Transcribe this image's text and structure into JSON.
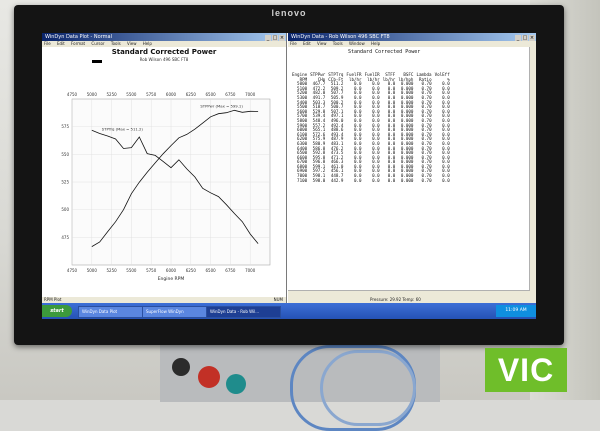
{
  "monitor": {
    "brand": "lenovo"
  },
  "left_window": {
    "title": "WinDyn Data Plot - Normal",
    "menu": [
      "File",
      "Edit",
      "Format",
      "Cursor",
      "Tools",
      "View",
      "Help"
    ],
    "status_left": "RPM Plot",
    "status_right": "NUM"
  },
  "right_window": {
    "title": "WinDyn Data - Rob Wilson 496 SBC FT8",
    "menu": [
      "File",
      "Edit",
      "View",
      "Tools",
      "Window",
      "Help"
    ],
    "report_title": "Standard Corrected Power",
    "columns_line1": [
      "Engine",
      "STPPwr",
      "STPTrq",
      "FuelFR",
      "FuelIR",
      "STFF",
      "BSFC",
      "Lambda",
      "VolEff"
    ],
    "columns_line2": [
      "RPM",
      "CHp",
      "CCb-Ft",
      "lb/hr",
      "lb/hr",
      "lb/hr",
      "lb/hph",
      "Ratio",
      "%"
    ],
    "rows": [
      [
        "5000",
        "467.7",
        "511.2",
        "0.0",
        "0.0",
        "0.0",
        "0.000",
        "0.70",
        "0.0"
      ],
      [
        "5100",
        "472.2",
        "509.2",
        "0.0",
        "0.0",
        "0.0",
        "0.000",
        "0.70",
        "0.0"
      ],
      [
        "5200",
        "482.0",
        "507.7",
        "0.0",
        "0.0",
        "0.0",
        "0.000",
        "0.70",
        "0.0"
      ],
      [
        "5300",
        "491.7",
        "505.9",
        "0.0",
        "0.0",
        "0.0",
        "0.000",
        "0.70",
        "0.0"
      ],
      [
        "5400",
        "503.3",
        "500.2",
        "0.0",
        "0.0",
        "0.0",
        "0.000",
        "0.70",
        "0.0"
      ],
      [
        "5500",
        "518.7",
        "500.7",
        "0.0",
        "0.0",
        "0.0",
        "0.000",
        "0.70",
        "0.0"
      ],
      [
        "5600",
        "529.8",
        "507.1",
        "0.0",
        "0.0",
        "0.0",
        "0.000",
        "0.70",
        "0.0"
      ],
      [
        "5700",
        "539.4",
        "497.1",
        "0.0",
        "0.0",
        "0.0",
        "0.000",
        "0.70",
        "0.0"
      ],
      [
        "5800",
        "548.4",
        "496.0",
        "0.0",
        "0.0",
        "0.0",
        "0.000",
        "0.70",
        "0.0"
      ],
      [
        "5900",
        "557.2",
        "492.4",
        "0.0",
        "0.0",
        "0.0",
        "0.000",
        "0.70",
        "0.0"
      ],
      [
        "6000",
        "565.1",
        "488.6",
        "0.0",
        "0.0",
        "0.0",
        "0.000",
        "0.70",
        "0.0"
      ],
      [
        "6100",
        "572.6",
        "493.4",
        "0.0",
        "0.0",
        "0.0",
        "0.000",
        "0.70",
        "0.0"
      ],
      [
        "6200",
        "575.9",
        "487.9",
        "0.0",
        "0.0",
        "0.0",
        "0.000",
        "0.70",
        "0.0"
      ],
      [
        "6300",
        "580.9",
        "483.1",
        "0.0",
        "0.0",
        "0.0",
        "0.000",
        "0.70",
        "0.0"
      ],
      [
        "6400",
        "586.8",
        "476.2",
        "0.0",
        "0.0",
        "0.0",
        "0.000",
        "0.70",
        "0.0"
      ],
      [
        "6500",
        "592.8",
        "473.5",
        "0.0",
        "0.0",
        "0.0",
        "0.000",
        "0.70",
        "0.0"
      ],
      [
        "6600",
        "595.8",
        "471.2",
        "0.0",
        "0.0",
        "0.0",
        "0.000",
        "0.70",
        "0.0"
      ],
      [
        "6700",
        "596.8",
        "466.3",
        "0.0",
        "0.0",
        "0.0",
        "0.000",
        "0.70",
        "0.0"
      ],
      [
        "6800",
        "599.1",
        "461.0",
        "0.0",
        "0.0",
        "0.0",
        "0.000",
        "0.70",
        "0.0"
      ],
      [
        "6900",
        "597.2",
        "456.1",
        "0.0",
        "0.0",
        "0.0",
        "0.000",
        "0.70",
        "0.0"
      ],
      [
        "7000",
        "598.1",
        "448.7",
        "0.0",
        "0.0",
        "0.0",
        "0.000",
        "0.70",
        "0.0"
      ],
      [
        "7100",
        "598.0",
        "442.9",
        "0.0",
        "0.0",
        "0.0",
        "0.000",
        "0.70",
        "0.0"
      ]
    ],
    "status_text": "Pressure: 29.92 Temp: 60"
  },
  "taskbar": {
    "start_label": "start",
    "tasks": [
      "WinDyn Data Plot",
      "SuperFlow WinDyn",
      "WinDyn Data - Rob Wil..."
    ],
    "clock": "11:09 AM"
  },
  "badge": {
    "text": "VIC",
    "color": "#6fbe2a"
  },
  "chart_data": {
    "type": "line",
    "title": "Standard Corrected Power",
    "subtitle": "Rob Wilson 496 SBC FT8",
    "xlabel": "Engine RPM",
    "x": [
      5000,
      5100,
      5200,
      5300,
      5400,
      5500,
      5600,
      5700,
      5800,
      5900,
      6000,
      6100,
      6200,
      6300,
      6400,
      6500,
      6600,
      6700,
      6800,
      6900,
      7000,
      7100
    ],
    "xlim": [
      4750,
      7250
    ],
    "xticks": [
      4750,
      5000,
      5250,
      5500,
      5750,
      6000,
      6250,
      6500,
      6750,
      7000
    ],
    "series": [
      {
        "name": "STPPwr (Max = 599.1)",
        "values": [
          467.7,
          472.2,
          482.0,
          491.7,
          503.3,
          518.7,
          529.8,
          539.4,
          548.4,
          557.2,
          565.1,
          572.6,
          575.9,
          580.9,
          586.8,
          592.8,
          595.8,
          596.8,
          599.1,
          597.2,
          598.1,
          598.0
        ],
        "ylim": [
          450,
          610
        ]
      },
      {
        "name": "STPTrq (Max = 511.2)",
        "values": [
          511.2,
          509.2,
          507.7,
          505.9,
          500.2,
          500.7,
          507.1,
          497.1,
          496.0,
          492.4,
          488.6,
          493.4,
          487.9,
          483.1,
          476.2,
          473.5,
          471.2,
          466.3,
          461.0,
          456.1,
          448.7,
          442.9
        ],
        "ylim": [
          430,
          530
        ]
      }
    ],
    "yticks_left": [
      "575",
      "550",
      "525",
      "500",
      "475"
    ],
    "grid": true,
    "legend": "inline-labels"
  }
}
